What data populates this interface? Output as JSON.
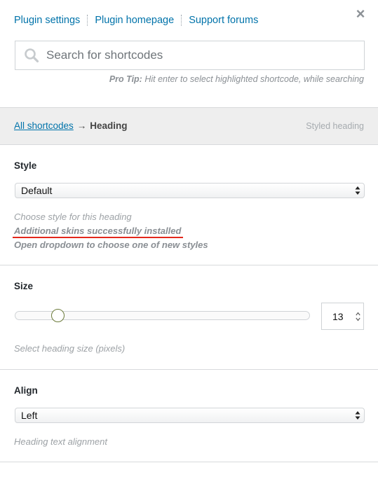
{
  "header": {
    "links": [
      "Plugin settings",
      "Plugin homepage",
      "Support forums"
    ],
    "close_label": "×"
  },
  "search": {
    "placeholder": "Search for shortcodes",
    "value": ""
  },
  "pro_tip": {
    "label": "Pro Tip:",
    "text": " Hit enter to select highlighted shortcode, while searching"
  },
  "breadcrumb": {
    "root": "All shortcodes",
    "arrow": "→",
    "current": "Heading",
    "preview_text": "Styled heading"
  },
  "fields": {
    "style": {
      "label": "Style",
      "value": "Default",
      "desc": "Choose style for this heading",
      "note_success": "Additional skins successfully installed",
      "note_hint": "Open dropdown to choose one of new styles"
    },
    "size": {
      "label": "Size",
      "value": "13",
      "slider_fraction": 0.13,
      "desc": "Select heading size (pixels)"
    },
    "align": {
      "label": "Align",
      "value": "Left",
      "desc": "Heading text alignment"
    }
  },
  "colors": {
    "link": "#0073aa",
    "underline_accent": "#e3271b",
    "breadcrumb_bg": "#eeeeee"
  }
}
